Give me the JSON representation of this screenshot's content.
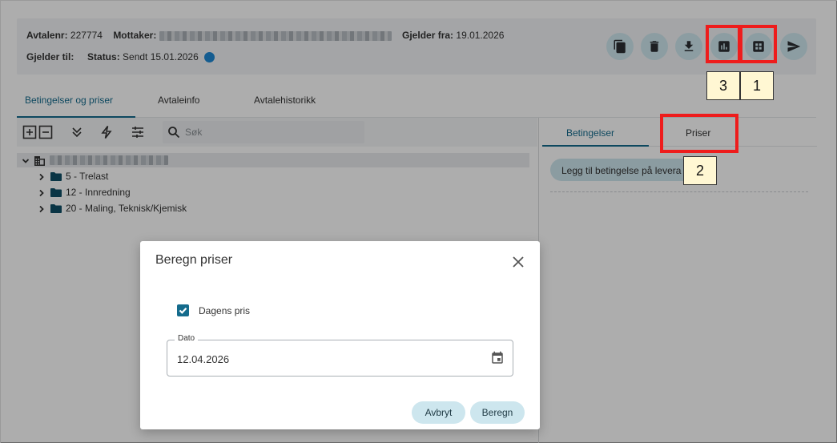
{
  "header": {
    "agreement_label": "Avtalenr:",
    "agreement_no": "227774",
    "receiver_label": "Mottaker:",
    "valid_from_label": "Gjelder fra:",
    "valid_from": "19.01.2026",
    "valid_to_label": "Gjelder til:",
    "status_label": "Status:",
    "status_value": "Sendt 15.01.2026",
    "status_color": "#1e88d4",
    "actions": [
      {
        "icon": "copy-icon"
      },
      {
        "icon": "delete-icon"
      },
      {
        "icon": "download-icon"
      },
      {
        "icon": "chart-icon"
      },
      {
        "icon": "grid-icon"
      },
      {
        "icon": "send-icon"
      }
    ]
  },
  "tabs": [
    {
      "label": "Betingelser og priser",
      "active": true
    },
    {
      "label": "Avtaleinfo",
      "active": false
    },
    {
      "label": "Avtalehistorikk",
      "active": false
    }
  ],
  "toolbar": {
    "icons": [
      "expand-all-icon",
      "collapse-all-icon",
      "double-chevron-down-icon",
      "lightning-icon",
      "filter-sliders-icon"
    ],
    "search_placeholder": "Søk"
  },
  "tree": {
    "children": [
      {
        "label": "5 - Trelast"
      },
      {
        "label": "12 - Innredning"
      },
      {
        "label": "20 - Maling, Teknisk/Kjemisk"
      }
    ]
  },
  "right_pane": {
    "tabs": [
      {
        "label": "Betingelser",
        "active": true
      },
      {
        "label": "Priser",
        "active": false
      }
    ],
    "add_button": "Legg til betingelse på levera"
  },
  "callouts": [
    {
      "number": "3"
    },
    {
      "number": "1"
    },
    {
      "number": "2"
    }
  ],
  "callout_color": "#ee1c1c",
  "dialog": {
    "title": "Beregn priser",
    "checkbox_label": "Dagens pris",
    "checkbox_checked": true,
    "date_label": "Dato",
    "date_value": "12.04.2026",
    "cancel_label": "Avbryt",
    "submit_label": "Beregn"
  },
  "colors": {
    "accent": "#146b8c",
    "button_bg": "#cde6ee"
  }
}
